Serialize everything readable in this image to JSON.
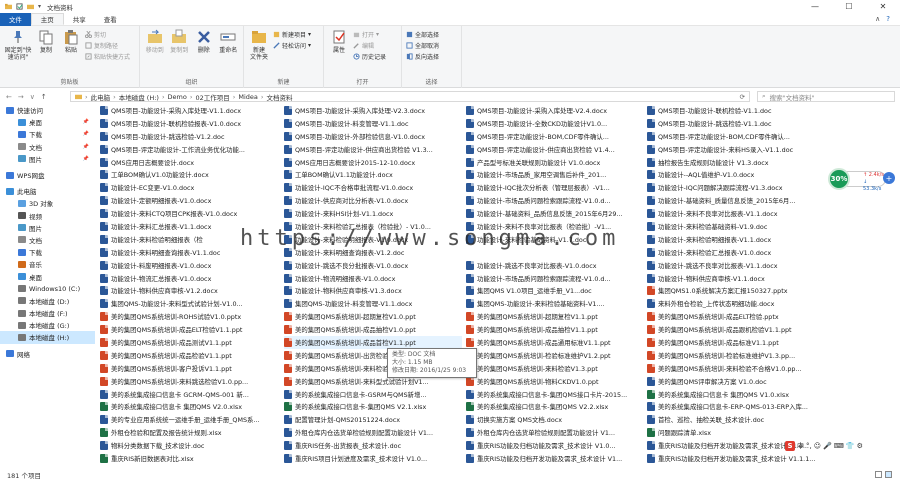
{
  "window": {
    "title": "文档资料",
    "controls": [
      "—",
      "☐",
      "✕"
    ]
  },
  "tabs": {
    "file": "文件",
    "home": "主页",
    "share": "共享",
    "view": "查看"
  },
  "ribbon": {
    "clipboard": {
      "name": "剪贴板",
      "pin": "固定到\"快速访问\"",
      "copy": "复制",
      "paste": "粘贴",
      "cut": "剪切",
      "copy_path": "复制路径",
      "paste_shortcut": "粘贴快捷方式"
    },
    "organize": {
      "name": "组织",
      "move_to": "移动到",
      "copy_to": "复制到",
      "delete": "删除",
      "rename": "重命名"
    },
    "new": {
      "name": "新建",
      "new_folder": "新建\n文件夹",
      "new_item": "新建项目",
      "easy_access": "轻松访问"
    },
    "open": {
      "name": "打开",
      "properties": "属性",
      "open": "打开",
      "edit": "编辑",
      "history": "历史记录"
    },
    "select": {
      "name": "选择",
      "select_all": "全部选择",
      "select_none": "全部取消",
      "invert": "反向选择"
    }
  },
  "address": {
    "path": [
      "此电脑",
      "本地磁盘 (H:)",
      "Demo",
      "02工作项目",
      "Midea",
      "文档资料"
    ],
    "search_placeholder": "搜索\"文档资料\""
  },
  "sidebar": {
    "items": [
      {
        "label": "快速访问",
        "pinned": false,
        "indent": 0
      },
      {
        "label": "桌面",
        "pinned": true,
        "indent": 1
      },
      {
        "label": "下载",
        "pinned": true,
        "indent": 1
      },
      {
        "label": "文档",
        "pinned": true,
        "indent": 1
      },
      {
        "label": "图片",
        "pinned": true,
        "indent": 1
      },
      {
        "label": "WPS网盘",
        "pinned": false,
        "indent": 0
      },
      {
        "label": "此电脑",
        "pinned": false,
        "indent": 0
      },
      {
        "label": "3D 对象",
        "pinned": false,
        "indent": 1
      },
      {
        "label": "视频",
        "pinned": false,
        "indent": 1
      },
      {
        "label": "图片",
        "pinned": false,
        "indent": 1
      },
      {
        "label": "文档",
        "pinned": false,
        "indent": 1
      },
      {
        "label": "下载",
        "pinned": false,
        "indent": 1
      },
      {
        "label": "音乐",
        "pinned": false,
        "indent": 1
      },
      {
        "label": "桌面",
        "pinned": false,
        "indent": 1
      },
      {
        "label": "Windows10 (C:)",
        "pinned": false,
        "indent": 1
      },
      {
        "label": "本地磁盘 (D:)",
        "pinned": false,
        "indent": 1
      },
      {
        "label": "本地磁盘 (F:)",
        "pinned": false,
        "indent": 1
      },
      {
        "label": "本地磁盘 (G:)",
        "pinned": false,
        "indent": 1
      },
      {
        "label": "本地磁盘 (H:)",
        "pinned": false,
        "indent": 1,
        "selected": true
      },
      {
        "label": "网络",
        "pinned": false,
        "indent": 0
      }
    ]
  },
  "files": {
    "columns": [
      [
        {
          "n": "QMS项目-功能设计-采购入库处理-V1.1.docx",
          "t": "w"
        },
        {
          "n": "QMS项目-功能设计-联机检验报表-V1.0.docx",
          "t": "w"
        },
        {
          "n": "QMS项目-功能设计-跳选检验-V1.2.doc",
          "t": "w"
        },
        {
          "n": "QMS项目-评定功能设计-工作流业务优化功能...",
          "t": "w"
        },
        {
          "n": "QMS应用日志概要设计.docx",
          "t": "w"
        },
        {
          "n": "工单BOM确认V1.0功能设计.docx",
          "t": "w"
        },
        {
          "n": "功能设计-EC变更-V1.0.docx",
          "t": "w"
        },
        {
          "n": "功能设计-定额明细报表-V1.0.docx",
          "t": "w"
        },
        {
          "n": "功能设计-来料CTQ项目CPK报表-V1.0.docx",
          "t": "w"
        },
        {
          "n": "功能设计-来料汇总报表-V1.1.docx",
          "t": "w"
        },
        {
          "n": "功能设计-来料检验明细报表（检",
          "t": "w"
        },
        {
          "n": "功能设计-来料明细查询报表-V1.1.doc",
          "t": "w"
        },
        {
          "n": "功能设计-料废明细报表-V1.0.docx",
          "t": "w"
        },
        {
          "n": "功能设计-物流汇总报表-V1.0.docx",
          "t": "w"
        },
        {
          "n": "功能设计-物料供应商审核-V1.2.docx",
          "t": "w"
        },
        {
          "n": "集团QMS-功能设计-来料型式试验计划-V1.0...",
          "t": "w"
        },
        {
          "n": "美的集团QMS系统培训-ROHS试验V1.0.pptx",
          "t": "p"
        },
        {
          "n": "美的集团QMS系统培训-成品ELT检验V1.1.ppt",
          "t": "p"
        },
        {
          "n": "美的集团QMS系统培训-成品测试V1.1.ppt",
          "t": "p"
        },
        {
          "n": "美的集团QMS系统培训-成品检验V1.1.ppt",
          "t": "p"
        },
        {
          "n": "美的集团QMS系统培训-客户投诉V1.1.ppt",
          "t": "p"
        },
        {
          "n": "美的集团QMS系统培训-来料跳选检验V1.0.pp...",
          "t": "p"
        },
        {
          "n": "美的系统集成接口信息卡 GCRM-QMS-001 新...",
          "t": "w"
        },
        {
          "n": "美的系统集成接口信息卡 集团QMS V2.0.xlsx",
          "t": "x"
        },
        {
          "n": "美的专业应用系统统一运维手册_运维手册_QMS系...",
          "t": "w"
        },
        {
          "n": "外租仓检验和配置及报告统计规则.xlsx",
          "t": "x"
        },
        {
          "n": "物料分类数据下载_技术设计.doc",
          "t": "w"
        },
        {
          "n": "重庆RIS新旧数据表对比.xlsx",
          "t": "x"
        }
      ],
      [
        {
          "n": "QMS项目-功能设计-采购入库处理-V2.3.docx",
          "t": "w"
        },
        {
          "n": "QMS项目-功能设计-料变管理-V1.1.doc",
          "t": "w"
        },
        {
          "n": "QMS项目-功能设计-外部检验信息-V1.0.docx",
          "t": "w"
        },
        {
          "n": "QMS项目-评定功能设计-供应商出货检验 V1.3...",
          "t": "w"
        },
        {
          "n": "QMS应用日志概要设计2015-12-10.docx",
          "t": "w"
        },
        {
          "n": "工单BOM确认V1.1功能设计.docx",
          "t": "w"
        },
        {
          "n": "功能设计-IQC不合格审批流程-V1.0.docx",
          "t": "w"
        },
        {
          "n": "功能设计-供应商对比分析表-V1.0.docx",
          "t": "w"
        },
        {
          "n": "功能设计-来料HSI计划-V1.1.docx",
          "t": "w"
        },
        {
          "n": "功能设计-来料检验汇总报表（检验批）- V1.0...",
          "t": "w"
        },
        {
          "n": "功能设计-来料检验明细报表-V1.0.docx",
          "t": "w"
        },
        {
          "n": "功能设计-来料明细查询报表-V1.2.doc",
          "t": "w"
        },
        {
          "n": "功能设计-跳选不良分批报表-V1.0.docx",
          "t": "w"
        },
        {
          "n": "功能设计-物流明细报表-V1.0.docx",
          "t": "w"
        },
        {
          "n": "功能设计-物料供应商审核-V1.3.docx",
          "t": "w"
        },
        {
          "n": "集团QMS-功能设计-料变管理-V1.1.docx",
          "t": "w"
        },
        {
          "n": "美的集团QMS系统培训-超期复检V1.0.ppt",
          "t": "p"
        },
        {
          "n": "美的集团QMS系统培训-成品抽检V1.0.ppt",
          "t": "p"
        },
        {
          "n": "美的集团QMS系统培训-成品首检V1.1.ppt",
          "t": "p"
        },
        {
          "n": "美的集团QMS系统培训-出货检验V1.1.ppt",
          "t": "p"
        },
        {
          "n": "美的集团QMS系统培训-来料检验V1.1.ppt",
          "t": "p"
        },
        {
          "n": "美的集团QMS系统培训-来料型式试验计划V1...",
          "t": "p"
        },
        {
          "n": "美的系统集成接口信息卡-GSRM与QMS新增...",
          "t": "w"
        },
        {
          "n": "美的系统集成接口信息卡-集团QMS V2.1.xlsx",
          "t": "x"
        },
        {
          "n": "配置管理计划-QMS20151224.docx",
          "t": "w"
        },
        {
          "n": "外租仓库内仓选货单检验规则配置功能设计 V1...",
          "t": "w"
        },
        {
          "n": "重庆RIS任务-出货报表_技术设计.doc",
          "t": "w"
        },
        {
          "n": "重庆RIS项目计划进度及需求_技术设计 V1.0...",
          "t": "w"
        }
      ],
      [
        {
          "n": "QMS项目-功能设计-采购入库处理-V2.4.docx",
          "t": "w"
        },
        {
          "n": "QMS项目-功能设计-全数CKD功能设计V1.0...",
          "t": "w"
        },
        {
          "n": "QMS项目-评定功能设计-BOM,CDF零件确认...",
          "t": "w"
        },
        {
          "n": "QMS项目-评定功能设计-供应商出货检验 V1.4...",
          "t": "w"
        },
        {
          "n": "产品型号标准关联规则功能设计 V1.0.docx",
          "t": "w"
        },
        {
          "n": "功能设计-市场品质_家用空调售后补件_201...",
          "t": "w"
        },
        {
          "n": "功能设计-IQC批次分析表（管理层报表）-V1...",
          "t": "w"
        },
        {
          "n": "功能设计-市场品质问题检索跟踪流程-V1.0.d...",
          "t": "w"
        },
        {
          "n": "功能设计-基础资料_品质信息反馈_2015年6月29...",
          "t": "w"
        },
        {
          "n": "功能设计-来料不良率对比报表（检验批）-V1...",
          "t": "w"
        },
        {
          "n": "功能设计-来料检验基础资料-V1.7.doc",
          "t": "w"
        },
        {
          "n": "",
          "t": ""
        },
        {
          "n": "功能设计-跳选不良率对比报表-V1.0.docx",
          "t": "w"
        },
        {
          "n": "功能设计-市场品质问题检索跟踪流程-V1.0.d...",
          "t": "w"
        },
        {
          "n": "集团QMS V1.0项目_运维手册_V1...doc",
          "t": "w"
        },
        {
          "n": "集团QMS-功能设计-来料检验基础资料-V1....",
          "t": "w"
        },
        {
          "n": "美的集团QMS系统培训-超期复检V1.1.ppt",
          "t": "p"
        },
        {
          "n": "美的集团QMS系统培训-成品抽检V1.1.ppt",
          "t": "p"
        },
        {
          "n": "美的集团QMS系统培训-成品通用标准V1.1.ppt",
          "t": "p"
        },
        {
          "n": "美的集团QMS系统培训-检验标准维护V1.2.ppt",
          "t": "p"
        },
        {
          "n": "美的集团QMS系统培训-来料检验V1.3.ppt",
          "t": "p"
        },
        {
          "n": "美的集团QMS系统培训-物料CKDV1.0.ppt",
          "t": "p"
        },
        {
          "n": "美的系统集成接口信息卡-集团QMS接口卡片-2015...",
          "t": "w"
        },
        {
          "n": "美的系统集成接口信息卡-集团QMS V2.2.xlsx",
          "t": "x"
        },
        {
          "n": "切换实施方案 QMS文档.docx",
          "t": "w"
        },
        {
          "n": "外租仓库内仓选货单检验规则配置功能设计 V1...",
          "t": "w"
        },
        {
          "n": "重庆RIS功能及归档功能及需求_技术设计 V1.0...",
          "t": "w"
        },
        {
          "n": "重庆RIS功能及归档开发功能及需求_技术设计 V1...",
          "t": "w"
        }
      ],
      [
        {
          "n": "QMS项目-功能设计-联机检验-V1.1.doc",
          "t": "w"
        },
        {
          "n": "QMS项目-功能设计-跳选检验-V1.1.doc",
          "t": "w"
        },
        {
          "n": "QMS项目-评定功能设计-BOM,CDF零件确认...",
          "t": "w"
        },
        {
          "n": "QMS项目-评定功能设计-来料HS录入-V1.1.doc",
          "t": "w"
        },
        {
          "n": "抽检报告生成规则功能设计 V1.3.docx",
          "t": "w"
        },
        {
          "n": "功能设计--AQL值维护-V1.0.docx",
          "t": "w"
        },
        {
          "n": "功能设计-IQC问题解决跟踪流程-V1.3.docx",
          "t": "w"
        },
        {
          "n": "功能设计-基础资料_质量信息反馈_2015年6月...",
          "t": "w"
        },
        {
          "n": "功能设计-来料不良率对比报表-V1.1.docx",
          "t": "w"
        },
        {
          "n": "功能设计-来料检验基础资料-V1.9.doc",
          "t": "w"
        },
        {
          "n": "功能设计-来料检验明细报表-V1.1.docx",
          "t": "w"
        },
        {
          "n": "功能设计-来料检验汇总报表-V1.0.docx",
          "t": "w"
        },
        {
          "n": "功能设计-跳选不良率对比报表-V1.1.docx",
          "t": "w"
        },
        {
          "n": "功能设计-物料供应商审核-V1.1.docx",
          "t": "w"
        },
        {
          "n": "集团QMS1.0系统解决方案汇报150327.pptx",
          "t": "p"
        },
        {
          "n": "来料外租仓检验_上传状态明细功能.docx",
          "t": "w"
        },
        {
          "n": "美的集团QMS系统培训-成品ELT检验.pptx",
          "t": "p"
        },
        {
          "n": "美的集团QMS系统培训-成品跟机检验V1.1.ppt",
          "t": "p"
        },
        {
          "n": "美的集团QMS系统培训-成品标准V1.1.ppt",
          "t": "p"
        },
        {
          "n": "美的集团QMS系统培训-检验标准维护V1.3.pp...",
          "t": "p"
        },
        {
          "n": "美的集团QMS系统培训-来料检验不合格V1.0.pp...",
          "t": "p"
        },
        {
          "n": "美的集团QMS评审解决方案 V1.0.doc",
          "t": "w"
        },
        {
          "n": "美的系统集成接口信息卡 集团QMS V1.0.xlsx",
          "t": "x"
        },
        {
          "n": "美的系统集成接口信息卡-ERP-QMS-013-ERP入库...",
          "t": "w"
        },
        {
          "n": "首检、巡检、抽检关联_技术设计.doc",
          "t": "w"
        },
        {
          "n": "问题跟踪清单.xlsx",
          "t": "x"
        },
        {
          "n": "重庆RIS功能及归档开发功能及需求_技术设计1.1.d...",
          "t": "w"
        },
        {
          "n": "重庆RIS功能及归档开发功能及需求_技术设计 V1.1.1...",
          "t": "w"
        }
      ]
    ]
  },
  "tooltip": {
    "type": "类型: DOC 文档",
    "size": "大小: 1.15 MB",
    "modified": "修改日期: 2016/1/25 9:03"
  },
  "watermark": "https://www.songma.com",
  "status": {
    "count": "181 个项目"
  },
  "gadget": {
    "percent": "30%",
    "up": "↑ 2.4k/s",
    "down": "↓ 53.3k/s",
    "plus": "+"
  },
  "tray": {
    "s_label": "S",
    "items": [
      "中",
      "°,",
      "☺",
      "🎤",
      "⌨",
      "👕",
      "⚙"
    ]
  },
  "colors": {
    "file_tab": "#1a62b8",
    "selection": "#cce8ff",
    "gadget_green": "#1a9b58"
  }
}
